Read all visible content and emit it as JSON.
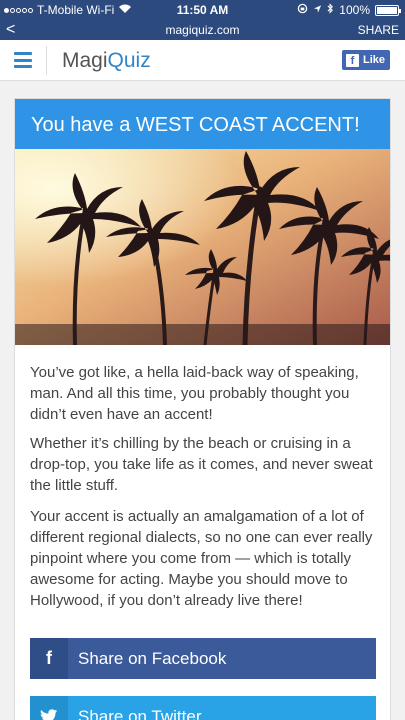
{
  "status": {
    "carrier": "T-Mobile Wi-Fi",
    "time": "11:50 AM",
    "battery": "100%"
  },
  "urlbar": {
    "url": "magiquiz.com",
    "share_label": "SHARE",
    "back_glyph": "<"
  },
  "header": {
    "logo_part1": "Magi",
    "logo_part2": "Quiz",
    "like_label": "Like",
    "fb_glyph": "f"
  },
  "result": {
    "title": "You have a WEST COAST ACCENT!",
    "paragraphs": [
      "You’ve got like, a hella laid-back way of speaking, man. And all this time, you probably thought you didn’t even have an accent!",
      "Whether it’s chilling by the beach or cruising in a drop-top, you take life as it comes, and never sweat the little stuff.",
      "Your accent is actually an amalgamation of a lot of different regional dialects, so no one can ever really pinpoint where you come from — which is totally awesome for acting. Maybe you should move to Hollywood, if you don’t already live there!"
    ]
  },
  "share": {
    "facebook_label": "Share on Facebook",
    "facebook_icon": "f",
    "twitter_label": "Share on Twitter",
    "twitter_icon": "t"
  },
  "colors": {
    "nav_bg": "#2d4a7e",
    "brand_blue": "#2f85c8",
    "title_bar": "#2f94e6",
    "facebook": "#3b5a9a",
    "twitter": "#2aa3e6"
  }
}
